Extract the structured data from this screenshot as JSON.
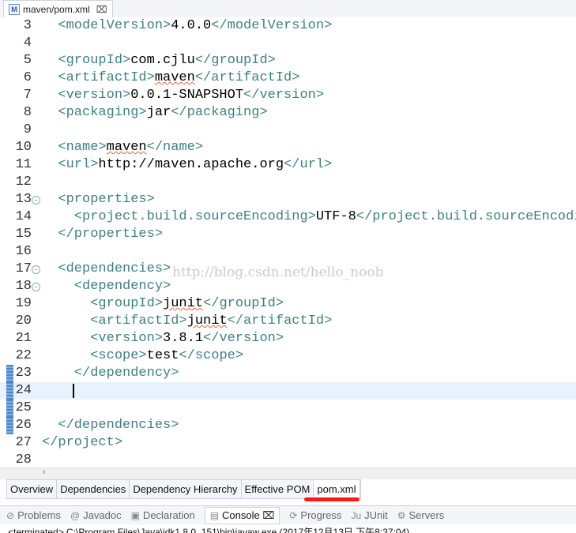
{
  "editor_tab": {
    "title": "maven/pom.xml",
    "close": "⌧"
  },
  "lines": [
    {
      "no": "3",
      "code": [
        {
          "t": "tag",
          "v": "  <modelVersion>"
        },
        {
          "t": "txt",
          "v": "4.0.0"
        },
        {
          "t": "tag",
          "v": "</modelVersion>"
        }
      ]
    },
    {
      "no": "4",
      "code": []
    },
    {
      "no": "5",
      "code": [
        {
          "t": "tag",
          "v": "  <groupId>"
        },
        {
          "t": "txt",
          "v": "com.cjlu"
        },
        {
          "t": "tag",
          "v": "</groupId>"
        }
      ]
    },
    {
      "no": "6",
      "code": [
        {
          "t": "tag",
          "v": "  <artifactId>"
        },
        {
          "t": "sq",
          "v": "maven"
        },
        {
          "t": "tag",
          "v": "</artifactId>"
        }
      ]
    },
    {
      "no": "7",
      "code": [
        {
          "t": "tag",
          "v": "  <version>"
        },
        {
          "t": "txt",
          "v": "0.0.1-SNAPSHOT"
        },
        {
          "t": "tag",
          "v": "</version>"
        }
      ]
    },
    {
      "no": "8",
      "code": [
        {
          "t": "tag",
          "v": "  <packaging>"
        },
        {
          "t": "txt",
          "v": "jar"
        },
        {
          "t": "tag",
          "v": "</packaging>"
        }
      ]
    },
    {
      "no": "9",
      "code": []
    },
    {
      "no": "10",
      "code": [
        {
          "t": "tag",
          "v": "  <name>"
        },
        {
          "t": "sq",
          "v": "maven"
        },
        {
          "t": "tag",
          "v": "</name>"
        }
      ]
    },
    {
      "no": "11",
      "code": [
        {
          "t": "tag",
          "v": "  <url>"
        },
        {
          "t": "txt",
          "v": "http://maven.apache.org"
        },
        {
          "t": "tag",
          "v": "</url>"
        }
      ]
    },
    {
      "no": "12",
      "code": []
    },
    {
      "no": "13",
      "fold": true,
      "code": [
        {
          "t": "tag",
          "v": "  <properties>"
        }
      ]
    },
    {
      "no": "14",
      "code": [
        {
          "t": "tag",
          "v": "    <project.build.sourceEncoding>"
        },
        {
          "t": "txt",
          "v": "UTF-8"
        },
        {
          "t": "tag",
          "v": "</project.build.sourceEncodin"
        }
      ]
    },
    {
      "no": "15",
      "code": [
        {
          "t": "tag",
          "v": "  </properties>"
        }
      ]
    },
    {
      "no": "16",
      "code": []
    },
    {
      "no": "17",
      "fold": true,
      "code": [
        {
          "t": "tag",
          "v": "  <dependencies>"
        }
      ]
    },
    {
      "no": "18",
      "fold": true,
      "code": [
        {
          "t": "tag",
          "v": "    <dependency>"
        }
      ]
    },
    {
      "no": "19",
      "code": [
        {
          "t": "tag",
          "v": "      <groupId>"
        },
        {
          "t": "sq",
          "v": "junit"
        },
        {
          "t": "tag",
          "v": "</groupId>"
        }
      ]
    },
    {
      "no": "20",
      "code": [
        {
          "t": "tag",
          "v": "      <artifactId>"
        },
        {
          "t": "sq",
          "v": "junit"
        },
        {
          "t": "tag",
          "v": "</artifactId>"
        }
      ]
    },
    {
      "no": "21",
      "code": [
        {
          "t": "tag",
          "v": "      <version>"
        },
        {
          "t": "txt",
          "v": "3.8.1"
        },
        {
          "t": "tag",
          "v": "</version>"
        }
      ]
    },
    {
      "no": "22",
      "code": [
        {
          "t": "tag",
          "v": "      <scope>"
        },
        {
          "t": "txt",
          "v": "test"
        },
        {
          "t": "tag",
          "v": "</scope>"
        }
      ]
    },
    {
      "no": "23",
      "marker": true,
      "code": [
        {
          "t": "tag",
          "v": "    </dependency>"
        }
      ]
    },
    {
      "no": "24",
      "marker": true,
      "current": true,
      "code": []
    },
    {
      "no": "25",
      "marker": true,
      "code": []
    },
    {
      "no": "26",
      "marker": true,
      "code": [
        {
          "t": "tag",
          "v": "  </dependencies>"
        }
      ]
    },
    {
      "no": "27",
      "code": [
        {
          "t": "tag",
          "v": "</project>"
        }
      ]
    },
    {
      "no": "28",
      "code": []
    }
  ],
  "watermark": "http://blog.csdn.net/hello_noob",
  "bottom_tabs": [
    "Overview",
    "Dependencies",
    "Dependency Hierarchy",
    "Effective POM",
    "pom.xml"
  ],
  "active_bottom_tab": "pom.xml",
  "view_tabs": [
    {
      "icon": "problems-icon",
      "glyph": "⊘",
      "label": "Problems"
    },
    {
      "icon": "javadoc-icon",
      "glyph": "@",
      "label": "Javadoc"
    },
    {
      "icon": "declaration-icon",
      "glyph": "▣",
      "label": "Declaration"
    },
    {
      "icon": "console-icon",
      "glyph": "▤",
      "label": "Console ⌧",
      "active": true
    },
    {
      "icon": "progress-icon",
      "glyph": "⟳",
      "label": "Progress"
    },
    {
      "icon": "junit-icon",
      "glyph": "Ju",
      "label": "JUnit"
    },
    {
      "icon": "servers-icon",
      "glyph": "⚙",
      "label": "Servers"
    }
  ],
  "console_status": "<terminated> C:\\Program Files\\Java\\jdk1.8.0_151\\bin\\javaw.exe (2017年12月13日 下午8:37:04)"
}
